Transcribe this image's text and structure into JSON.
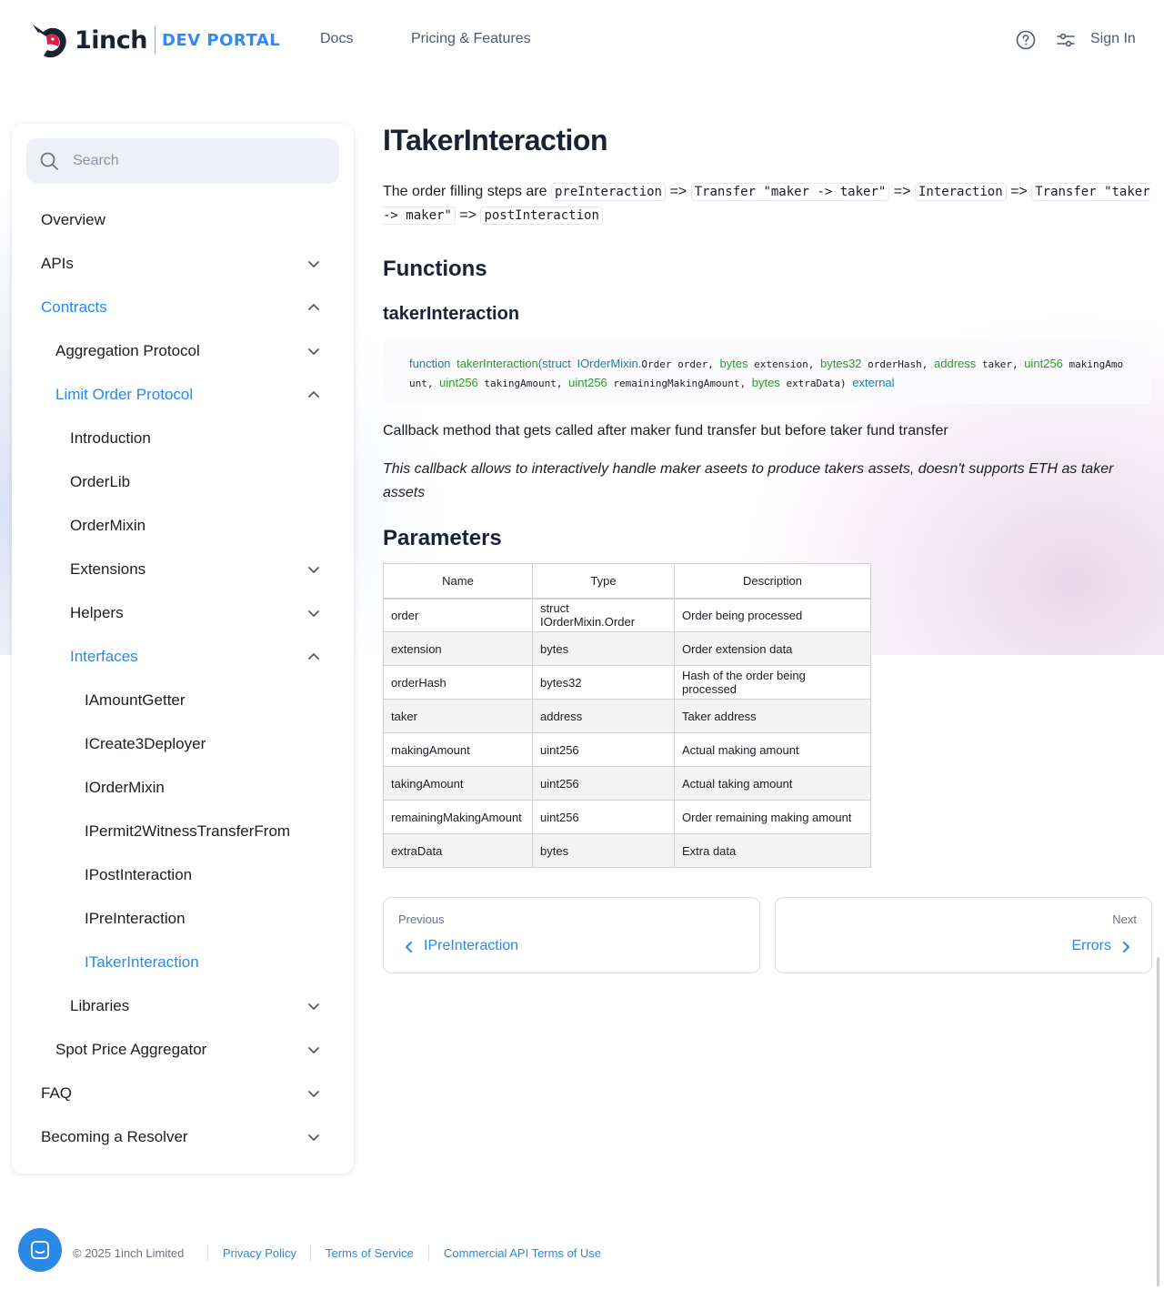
{
  "header": {
    "logo_word": "1inch",
    "logo_sub": "DEV PORTAL",
    "nav": [
      {
        "label": "Docs"
      },
      {
        "label": "Pricing & Features"
      }
    ],
    "help_icon": "question-circle-icon",
    "settings_icon": "sliders-icon",
    "sign_in": "Sign In"
  },
  "sidebar": {
    "search_placeholder": "Search",
    "items": [
      {
        "label": "Overview",
        "level": 0,
        "chevron": "none",
        "active": false
      },
      {
        "label": "APIs",
        "level": 0,
        "chevron": "down",
        "active": false
      },
      {
        "label": "Contracts",
        "level": 0,
        "chevron": "up",
        "active": true
      },
      {
        "label": "Aggregation Protocol",
        "level": 1,
        "chevron": "down",
        "active": false
      },
      {
        "label": "Limit Order Protocol",
        "level": 1,
        "chevron": "up",
        "active": true
      },
      {
        "label": "Introduction",
        "level": 2,
        "chevron": "none",
        "active": false
      },
      {
        "label": "OrderLib",
        "level": 2,
        "chevron": "none",
        "active": false
      },
      {
        "label": "OrderMixin",
        "level": 2,
        "chevron": "none",
        "active": false
      },
      {
        "label": "Extensions",
        "level": 2,
        "chevron": "down",
        "active": false
      },
      {
        "label": "Helpers",
        "level": 2,
        "chevron": "down",
        "active": false
      },
      {
        "label": "Interfaces",
        "level": 2,
        "chevron": "up",
        "active": true
      },
      {
        "label": "IAmountGetter",
        "level": 3,
        "chevron": "none",
        "active": false
      },
      {
        "label": "ICreate3Deployer",
        "level": 3,
        "chevron": "none",
        "active": false
      },
      {
        "label": "IOrderMixin",
        "level": 3,
        "chevron": "none",
        "active": false
      },
      {
        "label": "IPermit2WitnessTransferFrom",
        "level": 3,
        "chevron": "none",
        "active": false
      },
      {
        "label": "IPostInteraction",
        "level": 3,
        "chevron": "none",
        "active": false
      },
      {
        "label": "IPreInteraction",
        "level": 3,
        "chevron": "none",
        "active": false
      },
      {
        "label": "ITakerInteraction",
        "level": 3,
        "chevron": "none",
        "active": true
      },
      {
        "label": "Libraries",
        "level": 2,
        "chevron": "down",
        "active": false
      },
      {
        "label": "Spot Price Aggregator",
        "level": 1,
        "chevron": "down",
        "active": false
      },
      {
        "label": "FAQ",
        "level": 0,
        "chevron": "down",
        "active": false
      },
      {
        "label": "Becoming a Resolver",
        "level": 0,
        "chevron": "down",
        "active": false
      }
    ]
  },
  "content": {
    "title": "ITakerInteraction",
    "intro_prefix": "The order filling steps are",
    "steps": [
      "preInteraction",
      "Transfer \"maker -> taker\"",
      "Interaction",
      "Transfer \"taker -> maker\"",
      "postInteraction"
    ],
    "arrow": "=>",
    "functions_heading": "Functions",
    "function_name": "takerInteraction",
    "signature": {
      "kw_function": "function",
      "name": "takerInteraction",
      "kw_struct": "struct",
      "struct_type": "IOrderMixin.",
      "struct_rest": "Order order, ",
      "p2_type": "bytes",
      "p2_name": "extension, ",
      "p3_type": "bytes32",
      "p3_name": "orderHash, ",
      "p4_type": "address",
      "p4_name": "taker, ",
      "p5_type": "uint256",
      "p5_name": "makingAmount, ",
      "p6_type": "uint256",
      "p6_name": "takingAmount, ",
      "p7_type": "uint256",
      "p7_name": "remainingMakingAmount, ",
      "p8_type": "bytes",
      "p8_name": "extraData)",
      "visibility": "external"
    },
    "description": "Callback method that gets called after maker fund transfer but before taker fund transfer",
    "note": "This callback allows to interactively handle maker aseets to produce takers assets, doesn't supports ETH as taker assets",
    "parameters_heading": "Parameters",
    "table": {
      "headers": [
        "Name",
        "Type",
        "Description"
      ],
      "rows": [
        [
          "order",
          "struct IOrderMixin.Order",
          "Order being processed"
        ],
        [
          "extension",
          "bytes",
          "Order extension data"
        ],
        [
          "orderHash",
          "bytes32",
          "Hash of the order being processed"
        ],
        [
          "taker",
          "address",
          "Taker address"
        ],
        [
          "makingAmount",
          "uint256",
          "Actual making amount"
        ],
        [
          "takingAmount",
          "uint256",
          "Actual taking amount"
        ],
        [
          "remainingMakingAmount",
          "uint256",
          "Order remaining making amount"
        ],
        [
          "extraData",
          "bytes",
          "Extra data"
        ]
      ]
    },
    "pager": {
      "prev_small": "Previous",
      "prev_label": "IPreInteraction",
      "next_small": "Next",
      "next_label": "Errors"
    }
  },
  "footer": {
    "copyright": "© 2025 1inch Limited",
    "links": [
      "Privacy Policy",
      "Terms of Service",
      "Commercial API Terms of Use"
    ]
  },
  "colors": {
    "accent": "#2b88e6",
    "brand_dev": "#2f8af5",
    "code_type": "#2c9a2c",
    "code_keyword": "#1a7fa8"
  }
}
